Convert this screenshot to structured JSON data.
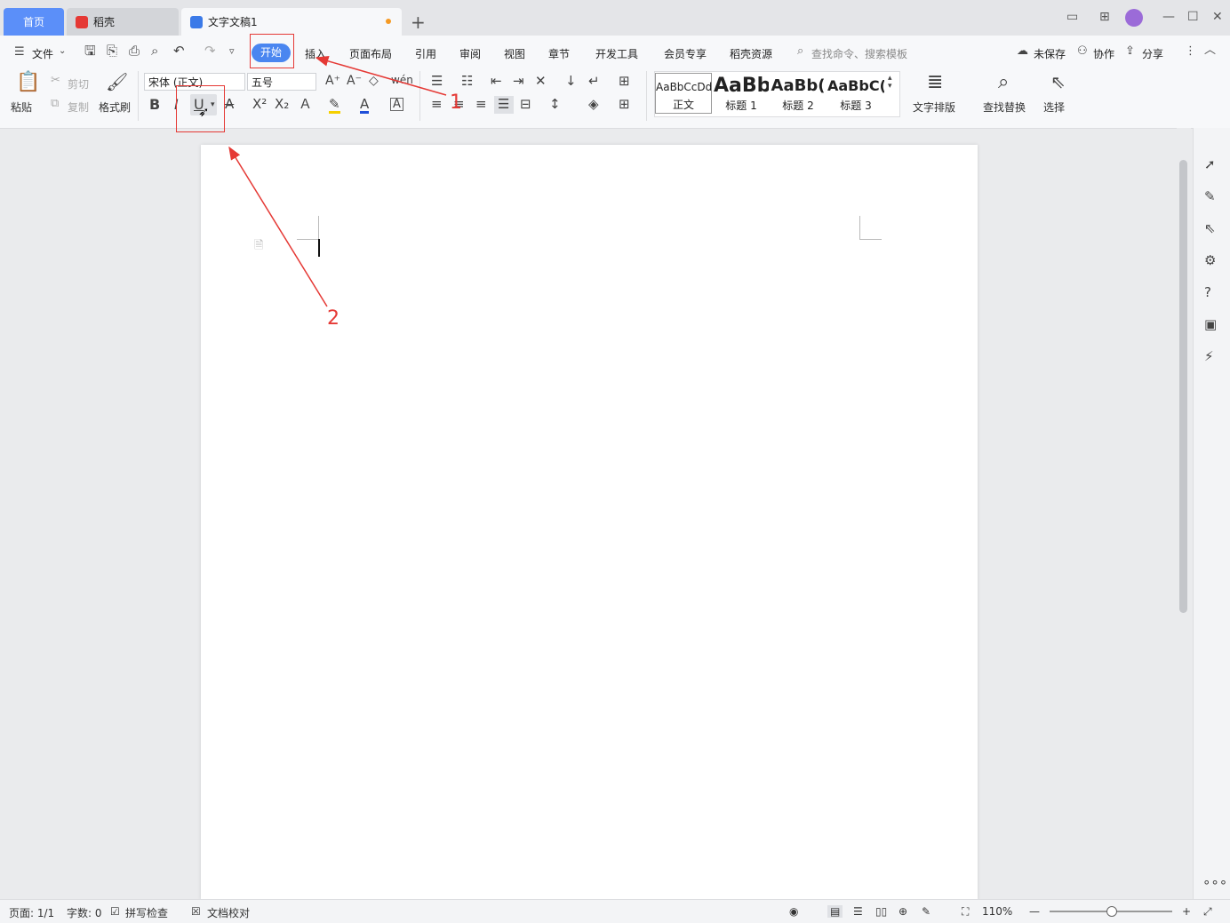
{
  "tabs": {
    "home": "首页",
    "daoke": "稻壳",
    "doc": "文字文稿1"
  },
  "menu": {
    "file": "文件",
    "start": "开始",
    "insert": "插入",
    "layout": "页面布局",
    "reference": "引用",
    "review": "审阅",
    "view": "视图",
    "chapter": "章节",
    "devtools": "开发工具",
    "member": "会员专享",
    "daoke_res": "稻壳资源",
    "search_placeholder": "查找命令、搜索模板",
    "unsaved": "未保存",
    "collab": "协作",
    "share": "分享"
  },
  "ribbon": {
    "paste": "粘贴",
    "cut": "剪切",
    "copy": "复制",
    "format_painter": "格式刷",
    "font_name": "宋体 (正文)",
    "font_size": "五号",
    "bold": "B",
    "italic": "I",
    "underline": "U",
    "text_layout": "文字排版",
    "find_replace": "查找替换",
    "select": "选择"
  },
  "styles": [
    {
      "preview": "AaBbCcDd",
      "name": "正文"
    },
    {
      "preview": "AaBb",
      "name": "标题 1"
    },
    {
      "preview": "AaBb(",
      "name": "标题 2"
    },
    {
      "preview": "AaBbC(",
      "name": "标题 3"
    }
  ],
  "annotations": {
    "label1": "1",
    "label2": "2",
    "color": "#e53935"
  },
  "status": {
    "page": "页面: 1/1",
    "words": "字数: 0",
    "spell": "拼写检查",
    "proof": "文档校对",
    "zoom": "110%"
  },
  "colors": {
    "accent": "#5b8ff9",
    "start_tab": "#4a86f0",
    "brand_red": "#e53935"
  }
}
